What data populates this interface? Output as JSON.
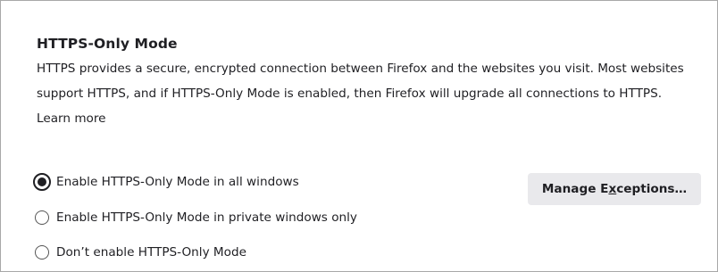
{
  "section": {
    "title": "HTTPS-Only Mode",
    "description": "HTTPS provides a secure, encrypted connection between Firefox and the websites you visit. Most websites support HTTPS, and if HTTPS-Only Mode is enabled, then Firefox will upgrade all connections to HTTPS.",
    "learn_more": "Learn more"
  },
  "options": [
    {
      "label": "Enable HTTPS-Only Mode in all windows",
      "selected": true
    },
    {
      "label": "Enable HTTPS-Only Mode in private windows only",
      "selected": false
    },
    {
      "label": "Don’t enable HTTPS-Only Mode",
      "selected": false
    }
  ],
  "manage_button": {
    "label_before": "Manage E",
    "label_access_key": "x",
    "label_after": "ceptions…"
  },
  "colors": {
    "text": "#1f1f23",
    "button_bg": "#e9e9ec",
    "border": "#a8a8a8"
  }
}
